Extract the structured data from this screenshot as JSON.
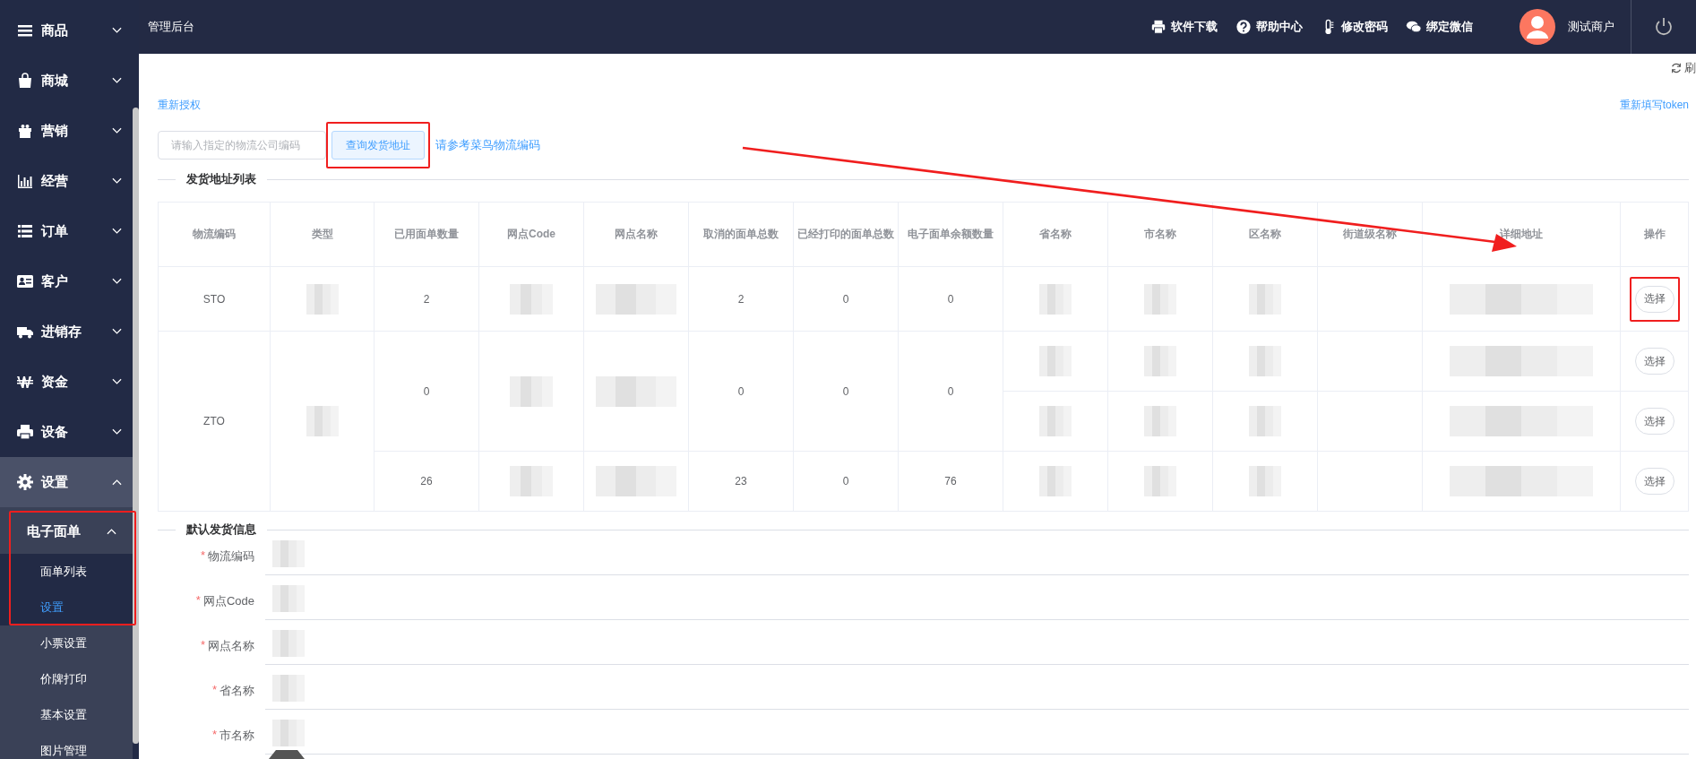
{
  "sidebar": {
    "items": [
      {
        "label": "商品",
        "expanded": false
      },
      {
        "label": "商城",
        "expanded": false
      },
      {
        "label": "营销",
        "expanded": false
      },
      {
        "label": "经营",
        "expanded": false
      },
      {
        "label": "订单",
        "expanded": false
      },
      {
        "label": "客户",
        "expanded": false
      },
      {
        "label": "进销存",
        "expanded": false
      },
      {
        "label": "资金",
        "expanded": false
      },
      {
        "label": "设备",
        "expanded": false
      },
      {
        "label": "设置",
        "expanded": true,
        "children": [
          {
            "label": "电子面单",
            "expanded": true,
            "highlighted": true,
            "children": [
              {
                "label": "面单列表",
                "selected": false
              },
              {
                "label": "设置",
                "selected": true
              }
            ]
          },
          {
            "label": "小票设置",
            "selected": false
          },
          {
            "label": "价牌打印",
            "selected": false
          },
          {
            "label": "基本设置",
            "selected": false
          },
          {
            "label": "图片管理",
            "selected": false
          }
        ]
      }
    ]
  },
  "header": {
    "title": "管理后台",
    "actions": [
      "软件下载",
      "帮助中心",
      "修改密码",
      "绑定微信"
    ],
    "user": "测试商户"
  },
  "refresh": "刷",
  "reauth_link": "重新授权",
  "token_link": "重新填写token",
  "search": {
    "placeholder": "请输入指定的物流公司编码",
    "button": "查询发货地址",
    "button_highlighted": true,
    "hint": "请参考菜鸟物流编码"
  },
  "address_section": "发货地址列表",
  "table": {
    "columns": [
      "物流编码",
      "类型",
      "已用面单数量",
      "网点Code",
      "网点名称",
      "取消的面单总数",
      "已经打印的面单总数",
      "电子面单余额数量",
      "省名称",
      "市名称",
      "区名称",
      "街道级名称",
      "详细地址",
      "操作"
    ],
    "rows": [
      {
        "code": "STO",
        "sites": [
          {
            "used": "2",
            "cancelled": "2",
            "printed": "0",
            "remaining": "0",
            "addresses": [
              {
                "action": "选择",
                "highlighted": true
              }
            ]
          }
        ]
      },
      {
        "code": "ZTO",
        "sites": [
          {
            "used": "0",
            "cancelled": "0",
            "printed": "0",
            "remaining": "0",
            "addresses": [
              {
                "action": "选择",
                "highlighted": false
              },
              {
                "action": "选择",
                "highlighted": false
              }
            ]
          },
          {
            "used": "26",
            "cancelled": "23",
            "printed": "0",
            "remaining": "76",
            "addresses": [
              {
                "action": "选择",
                "highlighted": false
              }
            ]
          }
        ]
      }
    ]
  },
  "annotation_arrow": true,
  "default_section": "默认发货信息",
  "form": [
    {
      "label": "物流编码",
      "required_mark": "*"
    },
    {
      "label": "网点Code",
      "required_mark": "*"
    },
    {
      "label": "网点名称",
      "required_mark": "*"
    },
    {
      "label": "省名称",
      "required_mark": "*"
    },
    {
      "label": "市名称",
      "required_mark": "*"
    }
  ]
}
